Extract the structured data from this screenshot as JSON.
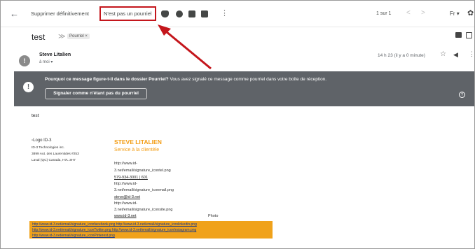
{
  "toolbar": {
    "back_glyph": "←",
    "delete_label": "Supprimer définitivement",
    "not_spam_label": "N'est pas un pourriel",
    "icons": [
      "shield-icon",
      "clock-icon",
      "mail-icon",
      "folder-icon",
      "tag-icon",
      "more-vert-icon"
    ],
    "pager": "1 sur 1",
    "lang": "Fr ▾",
    "prev_glyph": "<",
    "next_glyph": ">"
  },
  "message": {
    "subject": "test",
    "label_chip": "Pourriel ×",
    "sender_name": "Steve Litalien",
    "to_me": "à moi ▾",
    "timestamp": "14 h 23 (il y a 0 minute)",
    "avatar_letter": "!"
  },
  "spam_banner": {
    "question": "Pourquoi ce message figure-t-il dans le dossier Pourriel?",
    "explanation": " Vous avez signalé ce message comme pourriel dans votre boîte de réception.",
    "button_label": "Signaler comme n'étant pas du pourriel",
    "help_glyph": "?",
    "alert_glyph": "!"
  },
  "body": {
    "text": "test",
    "logo_alt": "Logo ID-3",
    "company_lines": [
      "ID-3 Technologies inc.",
      "3899 Aut. des Laurentides #253",
      "Laval (QC) Canada, H7L 3H7"
    ],
    "sig_name": "STEVE LITALIEN",
    "sig_role": "Service à la clientèle",
    "sig_lines": [
      "http://www.id-",
      "3.net/email/signature_icontel.png",
      "579-934-3001 | 601",
      "http://www.id-",
      "3.net/email/signature_iconmail.png",
      "steve@id-3.net",
      "http://www.id-",
      "3.net/email/signature_iconsite.png",
      "www.id-3.net"
    ],
    "photo_alt": "Photo",
    "social_lines": [
      "http://www.id-3.net/email/signature_iconfacebook.png http://www.id-3.net/email/signature_iconlinkedin.png",
      "http://www.id-3.net/email/signature_iconTwitter.png http://www.id-3.net/email/signature_iconInstagram.png",
      "http://www.id-3.net/email/signature_iconPinterest.png"
    ]
  },
  "colors": {
    "annotation": "#c4161c",
    "banner": "#5f6368",
    "signature_accent": "#f39c12",
    "social_bar": "#f0a21b"
  }
}
